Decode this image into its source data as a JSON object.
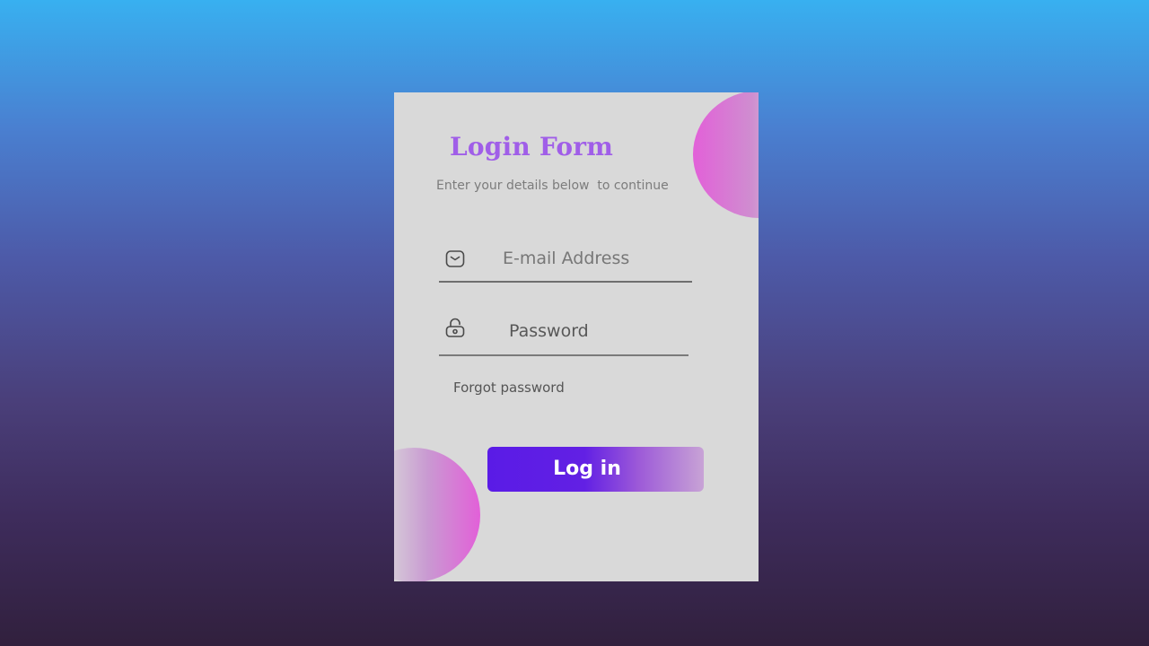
{
  "form": {
    "title": "Login Form",
    "subtitle": "Enter your details below  to continue",
    "email": {
      "placeholder": "E-mail Address",
      "icon": "mail-icon"
    },
    "password": {
      "placeholder": "Password",
      "icon": "lock-icon"
    },
    "forgot_label": "Forgot password",
    "submit_label": "Log in"
  },
  "colors": {
    "title": "#a05ee8",
    "card": "#d9d9d9",
    "button_start": "#5a1be6",
    "button_end": "#c8a3d6",
    "accent_pink": "#e260d8"
  }
}
